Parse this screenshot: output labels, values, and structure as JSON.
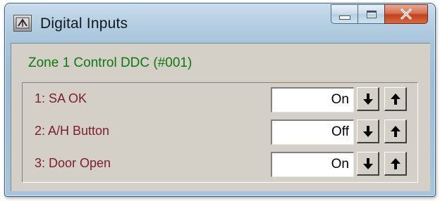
{
  "window": {
    "title": "Digital Inputs",
    "app_icon": "app-icon",
    "buttons": {
      "minimize": "minimize-icon",
      "maximize": "maximize-icon",
      "close_label": "X"
    }
  },
  "zone": {
    "title": "Zone 1 Control DDC (#001)"
  },
  "inputs": [
    {
      "label": "1: SA OK",
      "value": "On"
    },
    {
      "label": "2: A/H Button",
      "value": "Off"
    },
    {
      "label": "3: Door Open",
      "value": "On"
    }
  ],
  "colors": {
    "zone_title": "#0c7a0c",
    "input_label": "#7a1f2c",
    "client_bg": "#d4d0c8",
    "close_button": "#c2421f"
  },
  "icons": {
    "down": "arrow-down-icon",
    "up": "arrow-up-icon"
  }
}
